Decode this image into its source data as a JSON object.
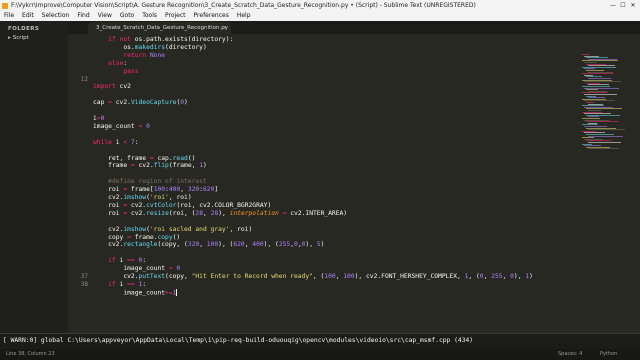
{
  "window": {
    "title": "F:\\Vykrr\\Improve\\Computer Vision\\Script\\A. Gesture Recognition\\3_Create_Scratch_Data_Gesture_Recognition.py • (Script) - Sublime Text (UNREGISTERED)",
    "minimize": "—",
    "maximize": "☐",
    "close": "✕"
  },
  "menu": [
    "File",
    "Edit",
    "Selection",
    "Find",
    "View",
    "Goto",
    "Tools",
    "Project",
    "Preferences",
    "Help"
  ],
  "sidebar": {
    "header": "FOLDERS",
    "folder": "Script",
    "folder_icon": "▸"
  },
  "tab": {
    "label": "3_Create_Scratch_Data_Gesture_Recognition.py",
    "close": "×"
  },
  "line_numbers": [
    "",
    "",
    "",
    "",
    "",
    "",
    "",
    "",
    "",
    "",
    "",
    "12",
    "",
    "",
    "",
    "",
    "",
    "",
    "",
    "",
    "",
    "",
    "",
    "",
    "",
    "",
    "",
    "",
    "",
    "",
    "",
    "",
    "",
    "",
    "",
    "",
    "37",
    "38"
  ],
  "code_lines": [
    [
      [
        "k",
        "    if not "
      ],
      [
        "",
        "os.path.exists(directory):"
      ]
    ],
    [
      [
        "",
        "        os."
      ],
      [
        "b",
        "makedirs"
      ],
      [
        "",
        "(directory)"
      ]
    ],
    [
      [
        "",
        "        "
      ],
      [
        "k",
        "return"
      ],
      [
        "",
        ""
      ],
      [
        "n",
        " None"
      ]
    ],
    [
      [
        "",
        "    "
      ],
      [
        "k",
        "else"
      ],
      [
        "",
        ":"
      ]
    ],
    [
      [
        "",
        "        "
      ],
      [
        "k",
        "pass"
      ]
    ],
    [],
    [
      [
        "k",
        "import"
      ],
      [
        "",
        " cv2"
      ]
    ],
    [],
    [
      [
        "",
        "cap "
      ],
      [
        "k",
        "="
      ],
      [
        "",
        " cv2."
      ],
      [
        "b",
        "VideoCapture"
      ],
      [
        "",
        "("
      ],
      [
        "n",
        "0"
      ],
      [
        "",
        ")"
      ]
    ],
    [],
    [
      [
        "",
        "i"
      ],
      [
        "k",
        "="
      ],
      [
        "n",
        "0"
      ]
    ],
    [
      [
        "",
        "image_count "
      ],
      [
        "k",
        "="
      ],
      [
        "n",
        " 0"
      ]
    ],
    [],
    [
      [
        "k",
        "while"
      ],
      [
        "",
        " i "
      ],
      [
        "k",
        "<"
      ],
      [
        "n",
        " 7"
      ],
      [
        "",
        ":"
      ]
    ],
    [],
    [
      [
        "",
        "    ret, frame "
      ],
      [
        "k",
        "="
      ],
      [
        "",
        " cap."
      ],
      [
        "b",
        "read"
      ],
      [
        "",
        "()"
      ]
    ],
    [
      [
        "",
        "    frame "
      ],
      [
        "k",
        "="
      ],
      [
        "",
        " cv2."
      ],
      [
        "b",
        "flip"
      ],
      [
        "",
        "(frame, "
      ],
      [
        "n",
        "1"
      ],
      [
        "",
        ")"
      ]
    ],
    [],
    [
      [
        "c",
        "    #define region of interest"
      ]
    ],
    [
      [
        "",
        "    roi "
      ],
      [
        "k",
        "="
      ],
      [
        "",
        " frame["
      ],
      [
        "n",
        "100"
      ],
      [
        "",
        ":"
      ],
      [
        "n",
        "400"
      ],
      [
        "",
        ", "
      ],
      [
        "n",
        "320"
      ],
      [
        "",
        ":"
      ],
      [
        "n",
        "620"
      ],
      [
        "",
        "]"
      ]
    ],
    [
      [
        "",
        "    cv2."
      ],
      [
        "b",
        "imshow"
      ],
      [
        "",
        "("
      ],
      [
        "s",
        "'roi'"
      ],
      [
        "",
        ", roi)"
      ]
    ],
    [
      [
        "",
        "    roi "
      ],
      [
        "k",
        "="
      ],
      [
        "",
        " cv2."
      ],
      [
        "b",
        "cvtColor"
      ],
      [
        "",
        "(roi, cv2.COLOR_BGR2GRAY)"
      ]
    ],
    [
      [
        "",
        "    roi "
      ],
      [
        "k",
        "="
      ],
      [
        "",
        " cv2."
      ],
      [
        "b",
        "resize"
      ],
      [
        "",
        "(roi, ("
      ],
      [
        "n",
        "28"
      ],
      [
        "",
        ", "
      ],
      [
        "n",
        "28"
      ],
      [
        "",
        "), "
      ],
      [
        "a",
        "interpolation"
      ],
      [
        "k",
        " = "
      ],
      [
        "",
        "cv2.INTER_AREA)"
      ]
    ],
    [],
    [
      [
        "",
        "    cv2."
      ],
      [
        "b",
        "imshow"
      ],
      [
        "",
        "("
      ],
      [
        "s",
        "'roi sacled and gray'"
      ],
      [
        "",
        ", roi)"
      ]
    ],
    [
      [
        "",
        "    copy "
      ],
      [
        "k",
        "="
      ],
      [
        "",
        " frame."
      ],
      [
        "b",
        "copy"
      ],
      [
        "",
        "()"
      ]
    ],
    [
      [
        "",
        "    cv2."
      ],
      [
        "b",
        "rectangle"
      ],
      [
        "",
        "(copy, ("
      ],
      [
        "n",
        "320"
      ],
      [
        "",
        ", "
      ],
      [
        "n",
        "100"
      ],
      [
        "",
        "), ("
      ],
      [
        "n",
        "620"
      ],
      [
        "",
        ", "
      ],
      [
        "n",
        "400"
      ],
      [
        "",
        "), ("
      ],
      [
        "n",
        "255"
      ],
      [
        "",
        ","
      ],
      [
        "n",
        "0"
      ],
      [
        "",
        ","
      ],
      [
        "n",
        "0"
      ],
      [
        "",
        "), "
      ],
      [
        "n",
        "5"
      ],
      [
        "",
        ")"
      ]
    ],
    [],
    [
      [
        "",
        "    "
      ],
      [
        "k",
        "if"
      ],
      [
        "",
        " i "
      ],
      [
        "k",
        "=="
      ],
      [
        "n",
        " 0"
      ],
      [
        "",
        ":"
      ]
    ],
    [
      [
        "",
        "        image_count "
      ],
      [
        "k",
        "="
      ],
      [
        "n",
        " 0"
      ]
    ],
    [
      [
        "",
        "        cv2."
      ],
      [
        "b",
        "putText"
      ],
      [
        "",
        "(copy, "
      ],
      [
        "s",
        "\"Hit Enter to Record when ready\""
      ],
      [
        "",
        ", ("
      ],
      [
        "n",
        "100"
      ],
      [
        "",
        ", "
      ],
      [
        "n",
        "100"
      ],
      [
        "",
        "), cv2.FONT_HERSHEY_COMPLEX, "
      ],
      [
        "n",
        "1"
      ],
      [
        "",
        ", ("
      ],
      [
        "n",
        "0"
      ],
      [
        "",
        ", "
      ],
      [
        "n",
        "255"
      ],
      [
        "",
        ", "
      ],
      [
        "n",
        "0"
      ],
      [
        "",
        "), "
      ],
      [
        "n",
        "1"
      ],
      [
        "",
        ")"
      ]
    ],
    [
      [
        "",
        "    "
      ],
      [
        "k",
        "if"
      ],
      [
        "",
        " i "
      ],
      [
        "k",
        "=="
      ],
      [
        "n",
        " 1"
      ],
      [
        "",
        ":"
      ]
    ],
    [
      [
        "",
        "        image_count"
      ],
      [
        "k",
        "+="
      ],
      [
        "n",
        "1"
      ]
    ]
  ],
  "console": "[ WARN:0] global C:\\Users\\appveyor\\AppData\\Local\\Temp\\1\\pip-req-build-oduouqig\\opencv\\modules\\videoio\\src\\cap_msmf.cpp (434)",
  "status": {
    "left": "Line 38, Column 23",
    "spaces": "Spaces: 4",
    "syntax": "Python"
  },
  "colors": {
    "editor_bg": "#272822",
    "keyword": "#f92672",
    "number": "#ae81ff",
    "string": "#e6db74",
    "function": "#66d9ef",
    "comment": "#75715e"
  }
}
